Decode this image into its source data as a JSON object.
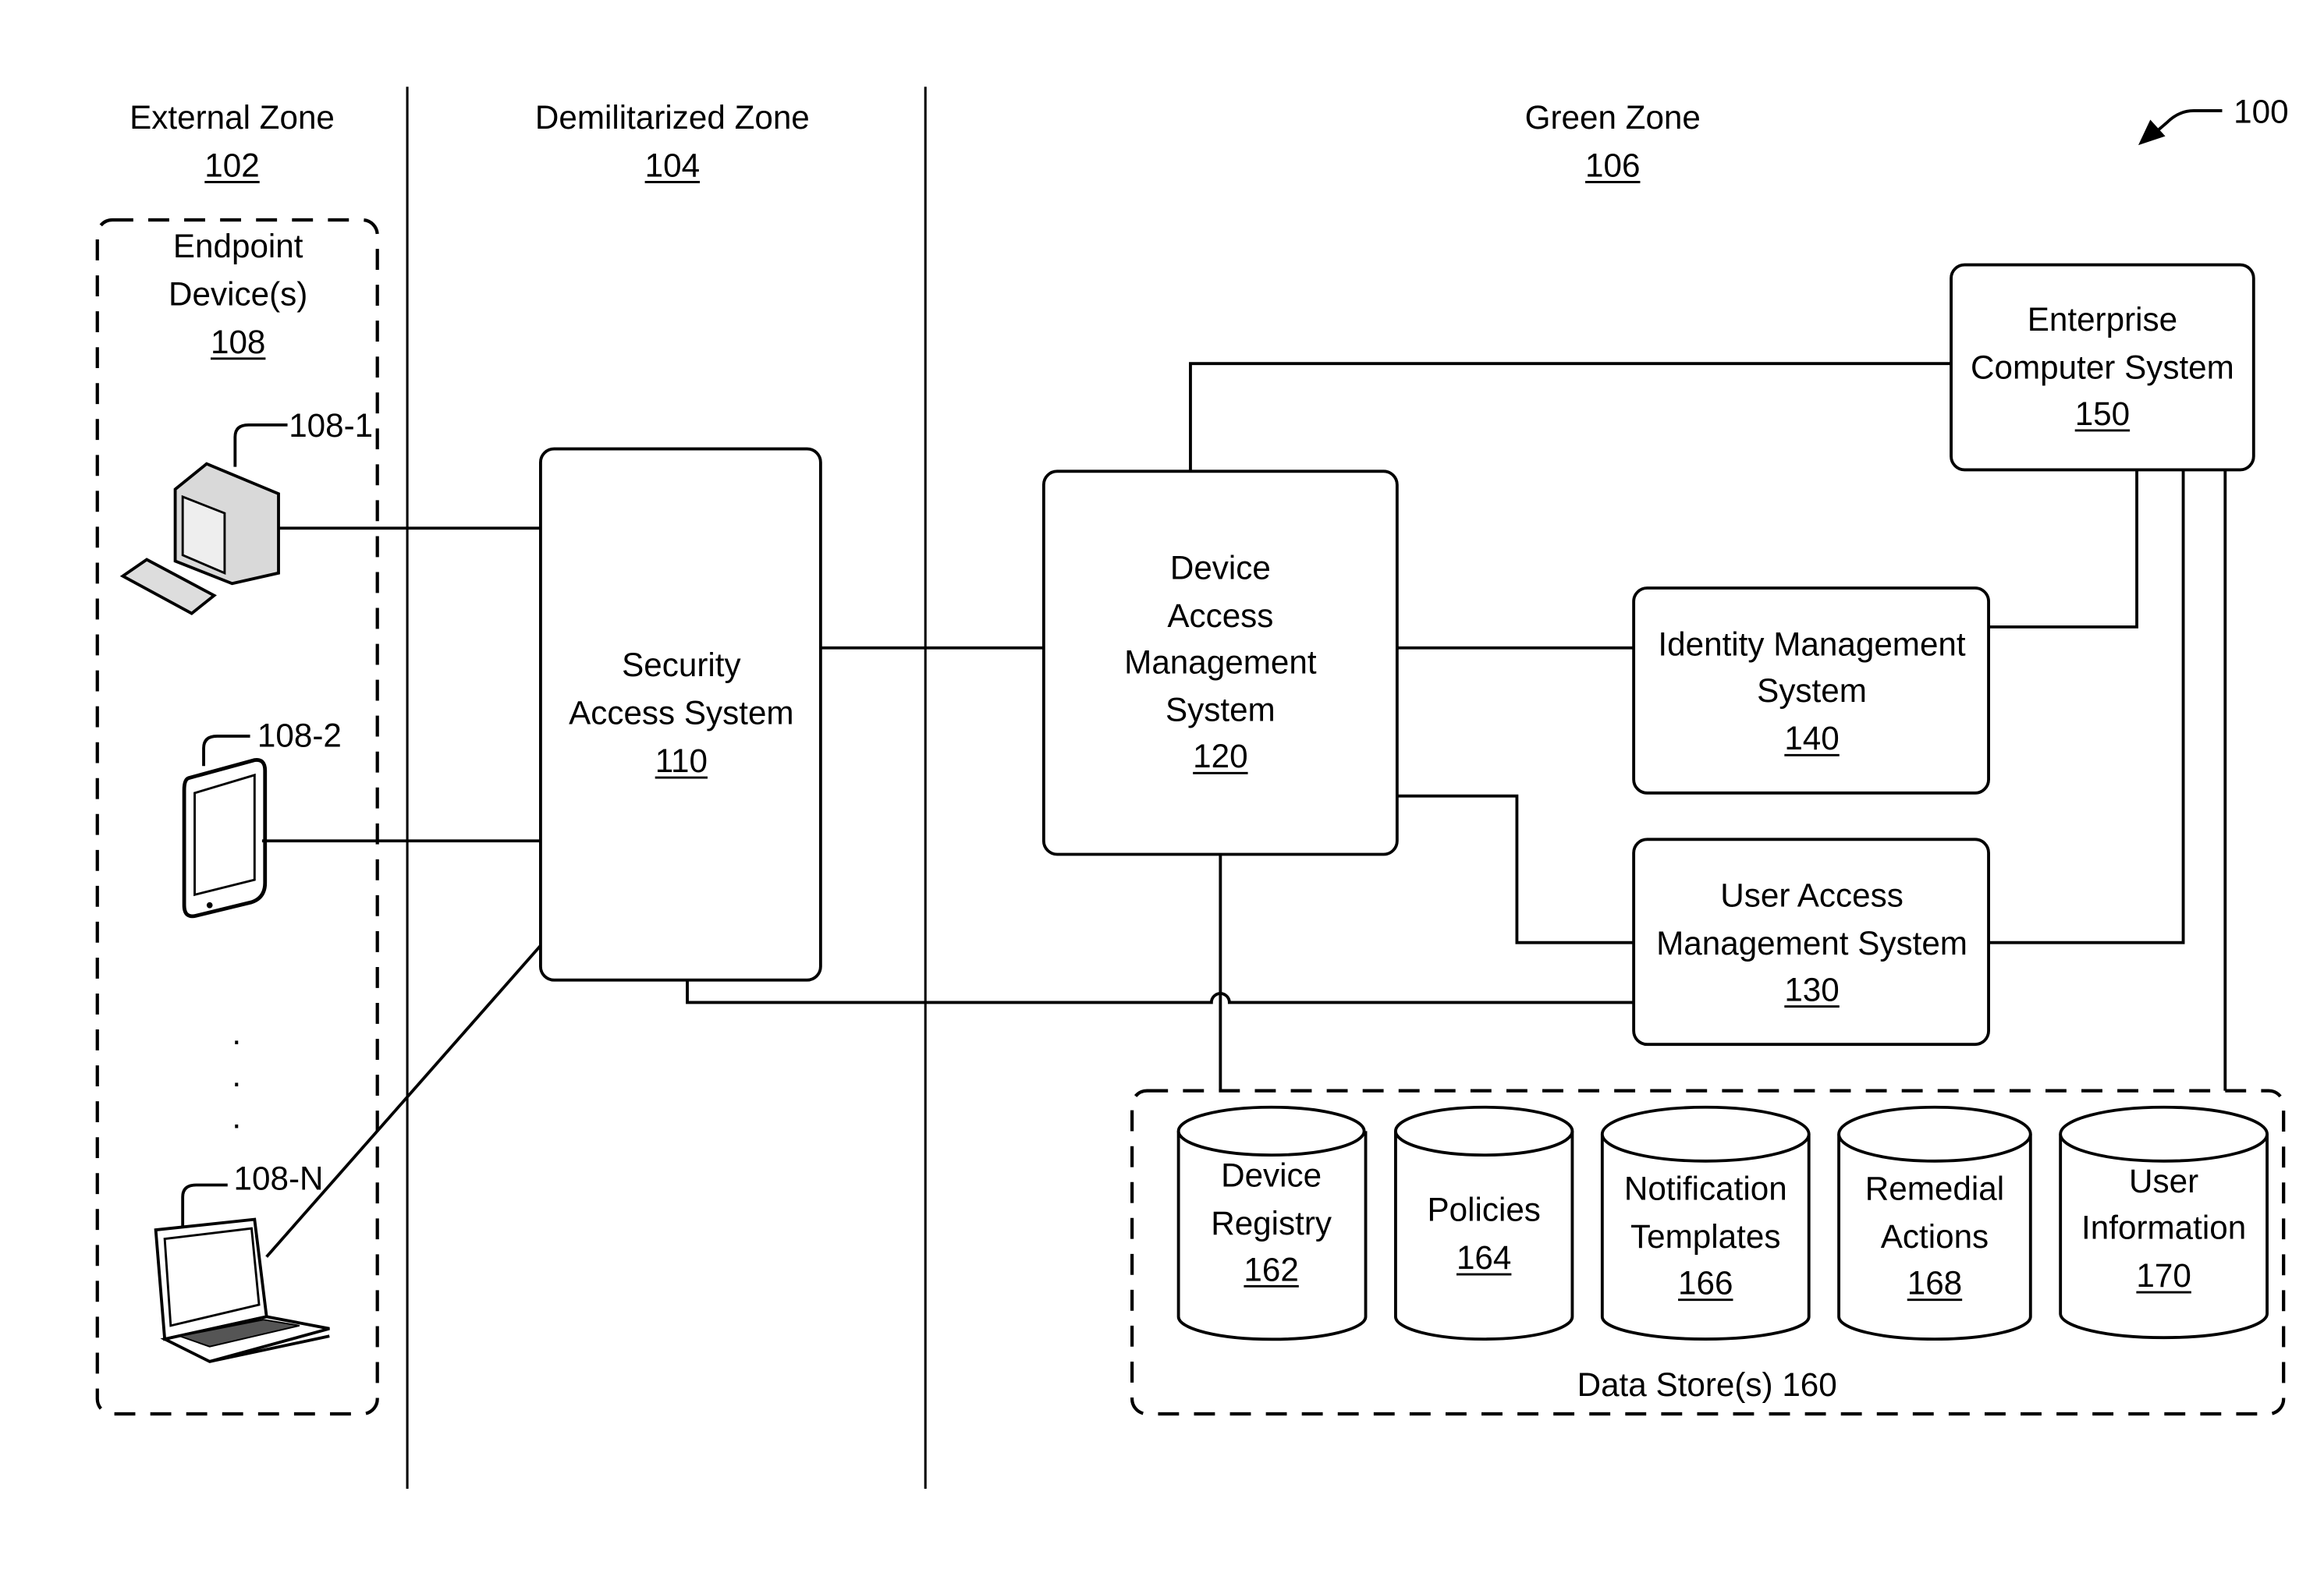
{
  "figure": {
    "ref": "100"
  },
  "zones": [
    {
      "name": "External Zone",
      "ref": "102"
    },
    {
      "name": "Demilitarized Zone",
      "ref": "104"
    },
    {
      "name": "Green Zone",
      "ref": "106"
    }
  ],
  "endpoints": {
    "group_line1": "Endpoint",
    "group_line2": "Device(s)",
    "group_ref": "108",
    "devices": [
      {
        "ref": "108-1",
        "type": "desktop-computer"
      },
      {
        "ref": "108-2",
        "type": "tablet"
      },
      {
        "ref": "108-N",
        "type": "laptop"
      }
    ],
    "ellipsis": ". . ."
  },
  "systems": {
    "security_access": {
      "line1": "Security",
      "line2": "Access System",
      "ref": "110"
    },
    "device_access_mgmt": {
      "line1": "Device",
      "line2": "Access",
      "line3": "Management",
      "line4": "System",
      "ref": "120"
    },
    "user_access_mgmt": {
      "line1": "User Access",
      "line2": "Management System",
      "ref": "130"
    },
    "identity_mgmt": {
      "line1": "Identity Management",
      "line2": "System",
      "ref": "140"
    },
    "enterprise": {
      "line1": "Enterprise",
      "line2": "Computer System",
      "ref": "150"
    }
  },
  "data_stores": {
    "label": "Data Store(s) 160",
    "items": [
      {
        "line1": "Device",
        "line2": "Registry",
        "ref": "162"
      },
      {
        "line1": "Policies",
        "line2": "",
        "ref": "164"
      },
      {
        "line1": "Notification",
        "line2": "Templates",
        "ref": "166"
      },
      {
        "line1": "Remedial",
        "line2": "Actions",
        "ref": "168"
      },
      {
        "line1": "User",
        "line2": "Information",
        "ref": "170"
      }
    ]
  }
}
